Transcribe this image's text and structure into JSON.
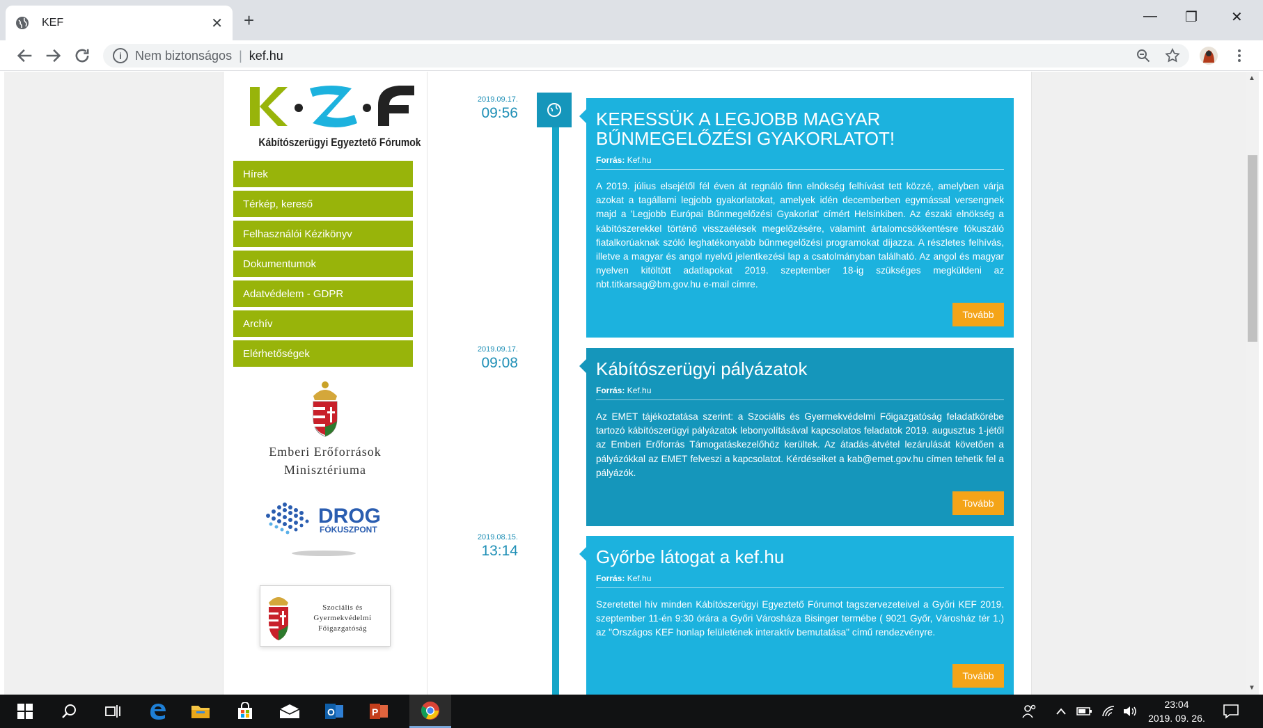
{
  "browser": {
    "tab_title": "KEF",
    "security_label": "Nem biztonságos",
    "url": "kef.hu"
  },
  "sidebar": {
    "logo_text": "K•Z•F",
    "logo_subtitle": "Kábítószerügyi Egyeztető Fórumok",
    "menu": [
      {
        "label": "Hírek"
      },
      {
        "label": "Térkép, kereső"
      },
      {
        "label": "Felhasználói Kézikönyv"
      },
      {
        "label": "Dokumentumok"
      },
      {
        "label": "Adatvédelem - GDPR"
      },
      {
        "label": "Archív"
      },
      {
        "label": "Elérhetőségek"
      }
    ],
    "emmi_line1": "Emberi Erőforrások",
    "emmi_line2": "Minisztériuma",
    "drog_title": "DROG",
    "drog_sub": "FÓKUSZPONT",
    "sgyf_text": "Szociális és Gyermekvédelmi Főigazgatóság"
  },
  "posts": [
    {
      "date": "2019.09.17.",
      "time": "09:56",
      "title": "KERESSÜK A LEGJOBB MAGYAR BŰNMEGELŐZÉSI GYAKORLATOT!",
      "source_label": "Forrás:",
      "source": "Kef.hu",
      "body": "A 2019. július elsejétől fél éven át regnáló finn elnökség felhívást tett közzé, amelyben várja azokat a tagállami legjobb gyakorlatokat, amelyek idén decemberben egymással versengnek majd a 'Legjobb Európai Bűnmegelőzési Gyakorlat' címért Helsinkiben. Az északi elnökség a kábítószerekkel történő visszaélések megelőzésére, valamint ártalomcsökkentésre fókuszáló fiatalkorúaknak szóló leghatékonyabb bűnmegelőzési programokat díjazza. A részletes felhívás, illetve a magyar és angol nyelvű jelentkezési lap a csatolmányban található. Az angol és magyar nyelven kitöltött adatlapokat 2019. szeptember 18-ig szükséges megküldeni az nbt.titkarsag@bm.gov.hu e-mail címre.",
      "more": "Tovább"
    },
    {
      "date": "2019.09.17.",
      "time": "09:08",
      "title": "Kábítószerügyi pályázatok",
      "source_label": "Forrás:",
      "source": "Kef.hu",
      "body": "Az EMET tájékoztatása szerint: a Szociális és Gyermekvédelmi Főigazgatóság feladatkörébe tartozó kábítószerügyi pályázatok lebonyolításával kapcsolatos feladatok 2019. augusztus 1-jétől az Emberi Erőforrás Támogatáskezelőhöz kerültek. Az átadás-átvétel lezárulását követően a pályázókkal az EMET felveszi a kapcsolatot. Kérdéseiket a kab@emet.gov.hu címen tehetik fel a pályázók.",
      "more": "Tovább"
    },
    {
      "date": "2019.08.15.",
      "time": "13:14",
      "title": "Győrbe látogat a kef.hu",
      "source_label": "Forrás:",
      "source": "Kef.hu",
      "body": "Szeretettel hív minden Kábítószerügyi Egyeztető Fórumot tagszervezeteivel a Győri KEF 2019. szeptember 11-én 9:30 órára a Győri Városháza Bisinger termébe ( 9021 Győr, Városház tér 1.) az \"Országos KEF honlap felületének interaktív bemutatása\" című rendezvényre.",
      "more": "Tovább"
    }
  ],
  "taskbar": {
    "time": "23:04",
    "date": "2019. 09. 26."
  },
  "colors": {
    "menu_green": "#98b40a",
    "card_light": "#1cb2de",
    "card_dark": "#1596bb",
    "button_orange": "#f4a418",
    "date_blue": "#1e8fb6"
  }
}
